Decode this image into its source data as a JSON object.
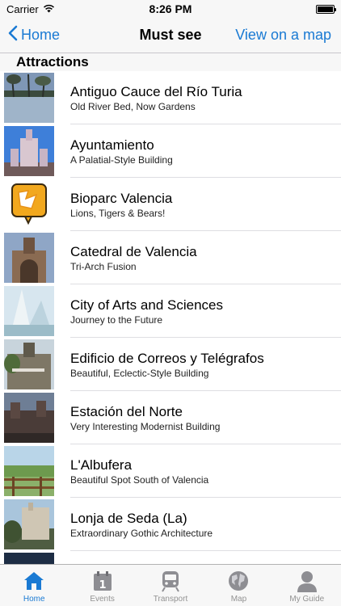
{
  "status": {
    "carrier": "Carrier",
    "time": "8:26 PM"
  },
  "nav": {
    "back_label": "Home",
    "title": "Must see",
    "right_label": "View on a map"
  },
  "section": {
    "header": "Attractions"
  },
  "items": [
    {
      "title": "Antiguo Cauce del Río Turia",
      "subtitle": "Old River Bed, Now Gardens"
    },
    {
      "title": "Ayuntamiento",
      "subtitle": "A Palatial-Style Building"
    },
    {
      "title": "Bioparc Valencia",
      "subtitle": "Lions, Tigers & Bears!"
    },
    {
      "title": "Catedral de Valencia",
      "subtitle": "Tri-Arch Fusion"
    },
    {
      "title": "City of Arts and Sciences",
      "subtitle": "Journey to the Future"
    },
    {
      "title": "Edificio de Correos y Telégrafos",
      "subtitle": "Beautiful, Eclectic-Style Building"
    },
    {
      "title": "Estación del Norte",
      "subtitle": "Very Interesting Modernist Building"
    },
    {
      "title": "L'Albufera",
      "subtitle": "Beautiful Spot South of Valencia"
    },
    {
      "title": "Lonja de Seda (La)",
      "subtitle": "Extraordinary Gothic Architecture"
    }
  ],
  "tabs": [
    {
      "label": "Home",
      "icon": "home-icon",
      "active": true
    },
    {
      "label": "Events",
      "icon": "calendar-icon",
      "active": false
    },
    {
      "label": "Transport",
      "icon": "train-icon",
      "active": false
    },
    {
      "label": "Map",
      "icon": "globe-icon",
      "active": false
    },
    {
      "label": "My Guide",
      "icon": "person-icon",
      "active": false
    }
  ],
  "colors": {
    "accent": "#1a7ad3",
    "bar_bg": "#f7f7f7",
    "inactive": "#929292"
  }
}
